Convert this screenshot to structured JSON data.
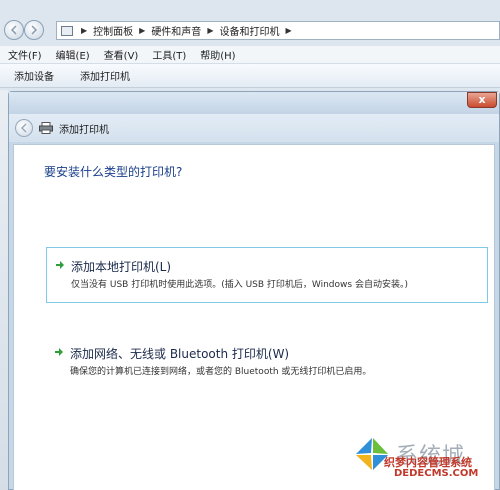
{
  "explorer": {
    "breadcrumb": [
      "控制面板",
      "硬件和声音",
      "设备和打印机"
    ],
    "menu": [
      "文件(F)",
      "编辑(E)",
      "查看(V)",
      "工具(T)",
      "帮助(H)"
    ],
    "toolbar": [
      "添加设备",
      "添加打印机"
    ]
  },
  "dialog": {
    "title": "添加打印机",
    "close_label": "x",
    "question": "要安装什么类型的打印机?",
    "options": [
      {
        "title": "添加本地打印机(L)",
        "description": "仅当没有 USB 打印机时使用此选项。(插入 USB 打印机后，Windows 会自动安装。)"
      },
      {
        "title": "添加网络、无线或 Bluetooth 打印机(W)",
        "description": "确保您的计算机已连接到网络，或者您的 Bluetooth 或无线打印机已启用。"
      }
    ]
  },
  "watermark": {
    "main": "系统城",
    "sub": "织梦内容管理系统",
    "url": "DEDECMS.COM"
  },
  "colors": {
    "accent_arrow": "#2e9e3a",
    "selection_border": "#7fc8e6",
    "question_text": "#1a3f8a"
  }
}
